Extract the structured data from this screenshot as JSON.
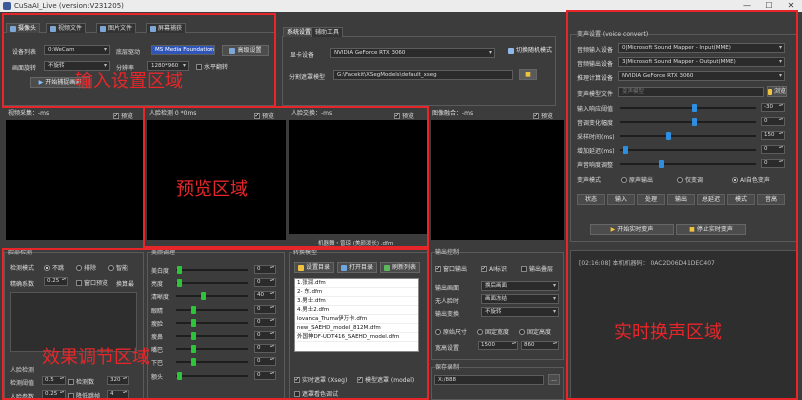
{
  "window": {
    "title": "CuSaAI_Live (version:V231205)",
    "minimize": "—",
    "maximize": "☐",
    "close": "✕"
  },
  "input_tabs": [
    {
      "label": "摄像头",
      "icon": "camera-icon"
    },
    {
      "label": "视频文件",
      "icon": "video-file-icon"
    },
    {
      "label": "图片文件",
      "icon": "image-file-icon"
    },
    {
      "label": "屏幕捕获",
      "icon": "screen-capture-icon"
    }
  ],
  "input": {
    "device_label": "设备列表",
    "device_value": "0:WeCam",
    "backend_label": "底层驱动",
    "backend_value": "MS Media Foundation",
    "advanced_button": "高级设置",
    "rotate_label": "画面旋转",
    "rotate_value": "不旋转",
    "resolution_label": "分辨率",
    "resolution_value": "1280*960",
    "flip_label": "水平翻转",
    "start_capture": "开始捕捉画面"
  },
  "system_tabs": [
    "系统设置",
    "辅助工具"
  ],
  "system": {
    "gpu_label": "显卡设备",
    "gpu_value": "NVIDIA GeForce RTX 3060",
    "lowmem_button": "切换随机模式",
    "model_label": "分割遮罩模型",
    "model_value": "G:\\Facekit\\XSegModels\\default_xseg"
  },
  "previews": [
    {
      "label": "视频采集：-ms"
    },
    {
      "label": "人脸检测 0 *0ms"
    },
    {
      "label": "人脸交换：-ms"
    },
    {
      "label": "图像融合：-ms"
    }
  ],
  "preview_common": {
    "preview_toggle": "预览",
    "file_label": "机器舞・曾琼 (美颜泼长) .dfm"
  },
  "face_detect": {
    "title": "脸部检测",
    "mode_label": "检测模式",
    "mode_options": [
      "不跳",
      "排除",
      "智能"
    ],
    "precision_label": "精确系数",
    "precision_value": "0.25",
    "window_check": "窗口预览",
    "swap_button": "换算最",
    "face_detect_section": "人脸检测",
    "threshold_label": "检测阈值",
    "threshold_value": "0.5",
    "face_count_label": "检测数",
    "face_count_value": "320",
    "coeff_label": "人脸参数",
    "coeff_value": "0.25",
    "track_label": "降低跳帧",
    "track_value": "4"
  },
  "beauty": {
    "title": "美颜调理",
    "rows": [
      {
        "label": "美白度",
        "value": "0",
        "level": 0.02
      },
      {
        "label": "亮度",
        "value": "0",
        "level": 0.02
      },
      {
        "label": "清晰度",
        "value": "40",
        "level": 0.38
      },
      {
        "label": "眼睛",
        "value": "0",
        "level": 0.22
      },
      {
        "label": "瘦脸",
        "value": "0",
        "level": 0.22
      },
      {
        "label": "瘦鼻",
        "value": "0",
        "level": 0.22
      },
      {
        "label": "嘴巴",
        "value": "0",
        "level": 0.22
      },
      {
        "label": "下巴",
        "value": "0",
        "level": 0.22
      },
      {
        "label": "额头",
        "value": "0",
        "level": 0.02
      }
    ]
  },
  "swap_model": {
    "title": "转换模型",
    "set_dir": "设置目录",
    "open_dir": "打开目录",
    "refresh": "刷新列表",
    "items": [
      "1.张润.dfm",
      "2- 东.dfm",
      "3.男士.dfm",
      "4.男士2.dfm",
      "lovanca_Truma伊万卡.dfm",
      "new_SAEHD_model_812M.dfm",
      "外国神DF-UDT416_SAEHD_model.dfm"
    ],
    "realtime_label": "实时遮罩 (Xseg)",
    "model_mask_label": "模型遮罩 (model)",
    "mask_color_label": "遮罩看色调试"
  },
  "output": {
    "title": "输出控制",
    "window_out": "窗口输出",
    "ai_mark": "AI标识",
    "output_multi": "输出叠层",
    "out_screen_label": "输出画面",
    "out_screen_value": "换后画面",
    "no_face_label": "无人脸时",
    "no_face_value": "画面冻结",
    "out_switch_label": "输出变换",
    "out_switch_value": "不旋转",
    "size_options": [
      "原始尺寸",
      "固定宽度",
      "固定高度"
    ],
    "size_label": "宽高设置",
    "width": "1500",
    "height": "860",
    "save_title": "保存录制",
    "save_path": "X:/888",
    "browse": "..."
  },
  "voice": {
    "title": "变声设置 (voice convert)",
    "in_dev_label": "音频输入设备",
    "in_dev_value": "0|Microsoft Sound Mapper - Input(MME)",
    "out_dev_label": "音频输出设备",
    "out_dev_value": "3|Microsoft Sound Mapper - Output(MME)",
    "compute_label": "推理计算设备",
    "compute_value": "NVIDIA GeForce RTX 3060",
    "model_label": "变声模型文件",
    "model_placeholder": "变声模型",
    "browse_label": "浏览",
    "sliders": [
      {
        "label": "输入响应阈值",
        "value": "-30",
        "level": 0.55
      },
      {
        "label": "音调变化幅度",
        "value": "0",
        "level": 0.55
      },
      {
        "label": "采样时间(ms)",
        "value": "150",
        "level": 0.35
      },
      {
        "label": "增加延迟(ms)",
        "value": "0",
        "level": 0.02
      },
      {
        "label": "声音响度调整",
        "value": "0",
        "level": 0.3
      }
    ],
    "mode_label": "变声模式",
    "modes": [
      "原声输出",
      "仅变调",
      "AI自色变声"
    ],
    "mode_buttons": [
      "状态",
      "输入",
      "处理",
      "输出",
      "总延迟",
      "模式",
      "音高"
    ],
    "start_button": "开始实时变声",
    "stop_button": "停止实时变声",
    "log": "[02:16:08] 本机机器码： 0AC2D06D41DEC407"
  },
  "annotations": [
    {
      "text": "输入设置区域",
      "color": "#e8262a"
    },
    {
      "text": "预览区域",
      "color": "#e8262a"
    },
    {
      "text": "效果调节区域",
      "color": "#e8262a"
    },
    {
      "text": "实时换声区域",
      "color": "#e8262a"
    }
  ]
}
